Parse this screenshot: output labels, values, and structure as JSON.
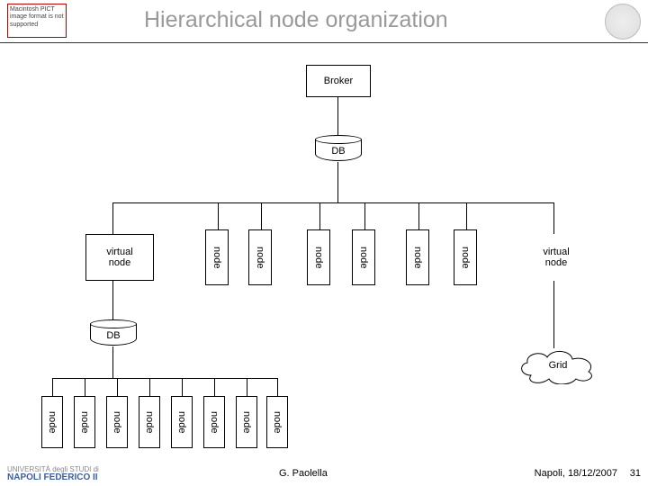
{
  "header": {
    "pict_notice": "Macintosh PICT image format is not supported",
    "title": "Hierarchical node organization"
  },
  "diagram": {
    "broker": "Broker",
    "db_top": "DB",
    "db_left": "DB",
    "virtual_node_left": "virtual\nnode",
    "virtual_node_right": "virtual\nnode",
    "grid": "Grid",
    "mid_nodes": [
      "node",
      "node",
      "node",
      "node",
      "node",
      "node"
    ],
    "bottom_nodes": [
      "node",
      "node",
      "node",
      "node",
      "node",
      "node",
      "node",
      "node"
    ]
  },
  "footer": {
    "university_line1": "UNIVERSITÀ degli STUDI di",
    "university_line2": "NAPOLI FEDERICO II",
    "author": "G. Paolella",
    "date": "Napoli, 18/12/2007",
    "page": "31"
  }
}
